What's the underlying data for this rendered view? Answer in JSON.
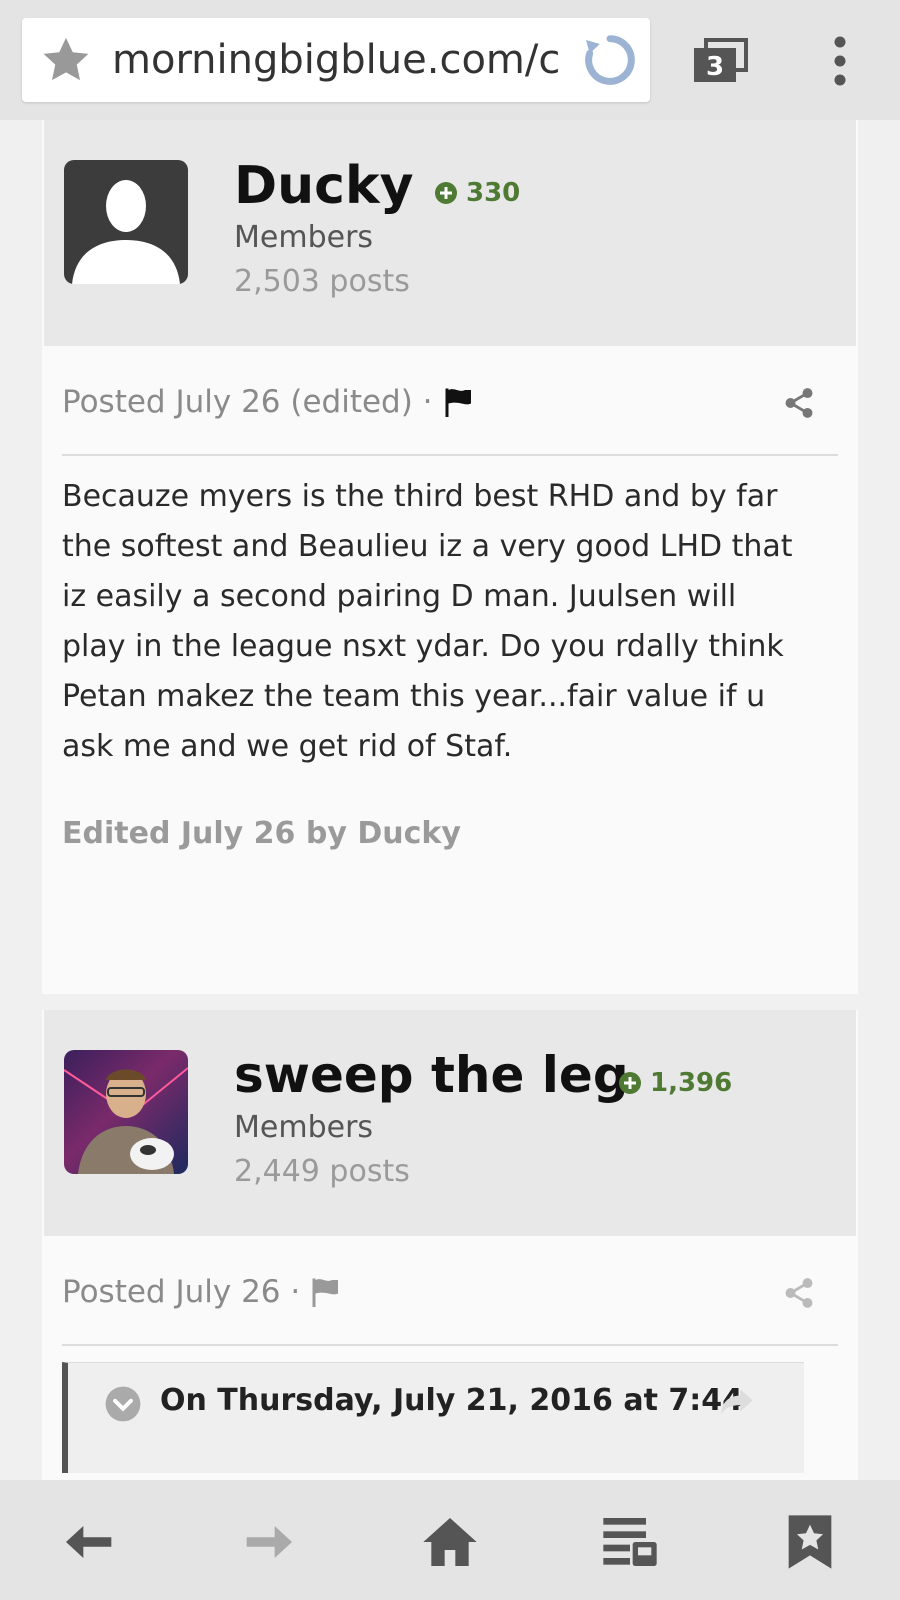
{
  "browser": {
    "url": "morningbigblue.com/c",
    "tab_count": "3"
  },
  "posts": [
    {
      "author": "Ducky",
      "reputation": "330",
      "group": "Members",
      "post_count": "2,503 posts",
      "posted": "Posted July 26 (edited) ·",
      "body": "Becauze myers is the third best RHD and by far the softest and Beaulieu iz a very good LHD that iz easily a second pairing D man. Juulsen will play in the league nsxt ydar. Do you rdally think Petan makez the team this year...fair value if u ask me and we get rid of Staf.",
      "edited_note": "Edited July 26 by Ducky"
    },
    {
      "author": "sweep the leg",
      "reputation": "1,396",
      "group": "Members",
      "post_count": "2,449 posts",
      "posted": "Posted July 26 ·",
      "quote_title": "On Thursday, July 21, 2016 at 7:44"
    }
  ],
  "icons": {
    "url_bar": [
      "star-icon",
      "reload-icon"
    ],
    "toolbar": [
      "tabs-icon",
      "overflow-menu-icon"
    ],
    "post": [
      "reputation-plus-icon",
      "report-flag-icon",
      "share-icon"
    ],
    "quote": [
      "quote-collapse-icon",
      "quote-link-icon"
    ],
    "bottom_nav": [
      "back-icon",
      "forward-icon",
      "home-icon",
      "reader-icon",
      "bookmarks-icon"
    ]
  },
  "colors": {
    "reputation_green": "#4f7a33",
    "reload_blue": "#9db3d4",
    "author_box_bg": "#e8e8e8"
  }
}
